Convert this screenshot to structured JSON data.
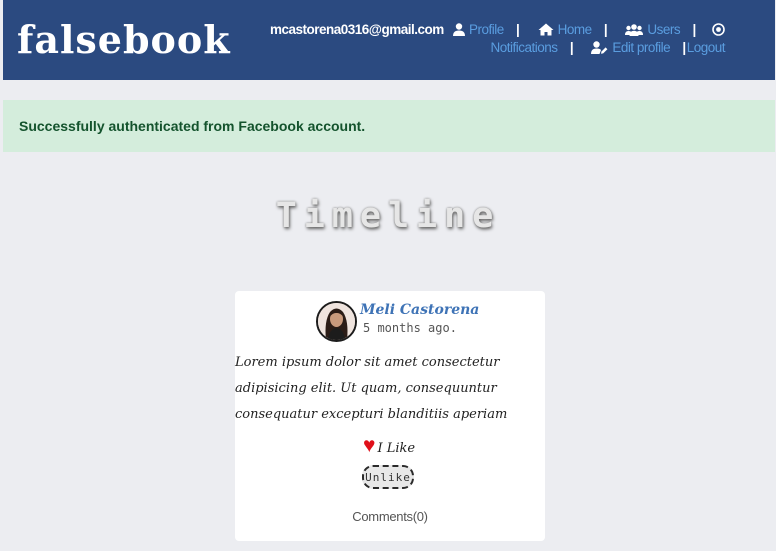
{
  "navbar": {
    "brand": "falsebook",
    "user_email": "mcastorena0316@gmail.com",
    "links": {
      "profile": "Profile",
      "home": "Home",
      "users": "Users",
      "notifications": "Notifications",
      "edit_profile": "Edit profile",
      "logout": "Logout"
    },
    "separator": "|",
    "colors": {
      "background": "#2b4a80",
      "link": "#5a9ddf"
    }
  },
  "alert": {
    "message": "Successfully authenticated from Facebook account.",
    "color": "#d4eddc"
  },
  "page": {
    "title": "Timeline"
  },
  "post": {
    "author": "Meli Castorena",
    "time_ago": "5 months ago.",
    "body": "Lorem ipsum dolor sit amet consectetur adipisicing elit. Ut quam, consequuntur consequatur excepturi blanditiis aperiam",
    "like_icon": "heart-icon",
    "like_label": "I Like",
    "unlike_label": "Unlike",
    "comments_label": "Comments",
    "comments_count": "(0)"
  }
}
